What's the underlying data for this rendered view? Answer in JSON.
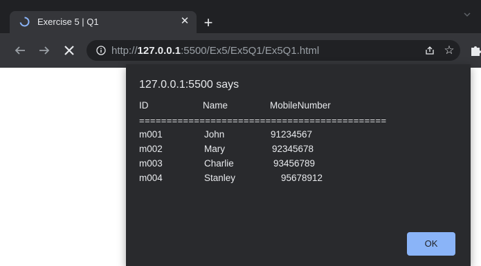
{
  "browser": {
    "tab": {
      "title": "Exercise 5 | Q1",
      "close_label": "✕"
    },
    "new_tab_label": "+",
    "url": {
      "scheme": "http://",
      "host": "127.0.0.1",
      "path": ":5500/Ex5/Ex5Q1/Ex5Q1.html"
    },
    "star_label": "☆"
  },
  "dialog": {
    "title": "127.0.0.1:5500 says",
    "columns": [
      "ID",
      "Name",
      "MobileNumber"
    ],
    "separator": "=============================================",
    "rows": [
      [
        "m001",
        "John",
        "91234567"
      ],
      [
        "m002",
        "Mary",
        "92345678"
      ],
      [
        "m003",
        "Charlie",
        "93456789"
      ],
      [
        "m004",
        "Stanley",
        "95678912"
      ]
    ],
    "ok_label": "OK"
  },
  "colors": {
    "tabstrip": "#202124",
    "toolbar": "#35363a",
    "dialog_bg": "#292a2d",
    "accent": "#8ab4f8"
  }
}
